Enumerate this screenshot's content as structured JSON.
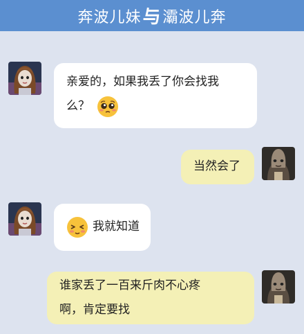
{
  "header": {
    "title_left": "奔波儿妹",
    "title_sep": "与",
    "title_right": "灞波儿奔"
  },
  "messages": [
    {
      "sender": "left",
      "lines": [
        "亲爱的，如果我丢了你会找我",
        "么？"
      ],
      "emoji": "pleading-face-icon"
    },
    {
      "sender": "right",
      "lines": [
        "当然会了"
      ]
    },
    {
      "sender": "left",
      "lines": [
        "我就知道"
      ],
      "emoji": "blushing-face-icon"
    },
    {
      "sender": "right",
      "lines": [
        "谁家丢了一百来斤肉不心疼",
        "啊，肯定要找"
      ]
    }
  ],
  "colors": {
    "header_bg": "#5b8fd0",
    "chat_bg": "#dde3ef",
    "left_bubble": "#ffffff",
    "right_bubble": "#f4f0b6"
  }
}
